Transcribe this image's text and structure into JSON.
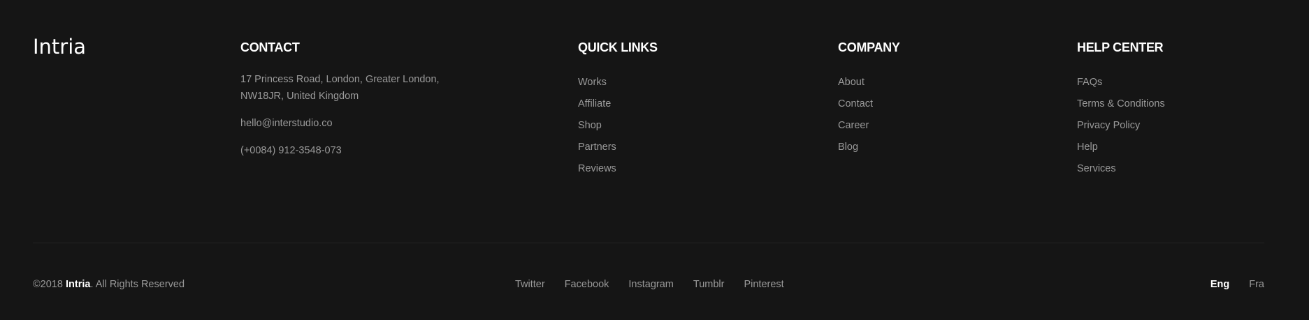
{
  "brand": {
    "logo": "Intria"
  },
  "contact": {
    "heading": "CONTACT",
    "address_line1": "17 Princess Road, London, Greater London,",
    "address_line2": "NW18JR, United Kingdom",
    "email": "hello@interstudio.co",
    "phone": "(+0084) 912-3548-073"
  },
  "quick_links": {
    "heading": "QUICK LINKS",
    "items": [
      "Works",
      "Affiliate",
      "Shop",
      "Partners",
      "Reviews"
    ]
  },
  "company": {
    "heading": "COMPANY",
    "items": [
      "About",
      "Contact",
      "Career",
      "Blog"
    ]
  },
  "help_center": {
    "heading": "HELP CENTER",
    "items": [
      "FAQs",
      "Terms & Conditions",
      "Privacy Policy",
      "Help",
      "Services"
    ]
  },
  "bottom": {
    "copyright_prefix": "©2018 ",
    "copyright_brand": "Intria",
    "copyright_suffix": ". All Rights Reserved",
    "social": [
      "Twitter",
      "Facebook",
      "Instagram",
      "Tumblr",
      "Pinterest"
    ],
    "languages": [
      "Eng",
      "Fra"
    ],
    "active_language": "Eng"
  },
  "colors": {
    "background": "#151515",
    "heading": "#ffffff",
    "text": "#9a9a9a",
    "divider": "#242424"
  }
}
